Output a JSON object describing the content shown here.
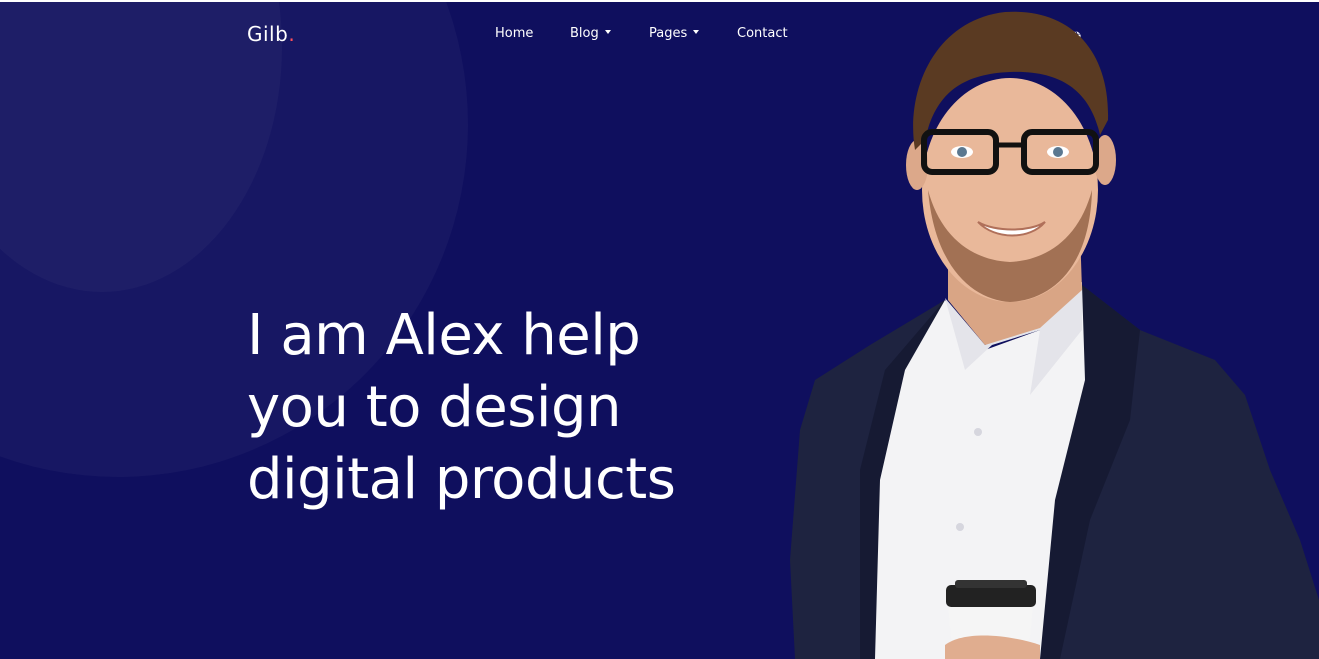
{
  "brand": {
    "name": "Gilb",
    "dot": "."
  },
  "nav": {
    "items": [
      {
        "label": "Home",
        "has_dropdown": false
      },
      {
        "label": "Blog",
        "has_dropdown": true
      },
      {
        "label": "Pages",
        "has_dropdown": true
      },
      {
        "label": "Contact",
        "has_dropdown": false
      }
    ]
  },
  "social": {
    "icons": [
      "facebook-icon",
      "instagram-icon",
      "behance-icon",
      "website-icon"
    ],
    "behance_text": "Bē"
  },
  "hero": {
    "headline_lines": [
      "I am Alex help",
      "you to design",
      "digital products"
    ]
  },
  "colors": {
    "background": "#0f0f5e",
    "text": "#ffffff",
    "accent": "#ff4f5a",
    "jacket": "#1e2340",
    "shirt": "#f3f3f5",
    "skin": "#e9b89a",
    "hair": "#5a3a22"
  }
}
